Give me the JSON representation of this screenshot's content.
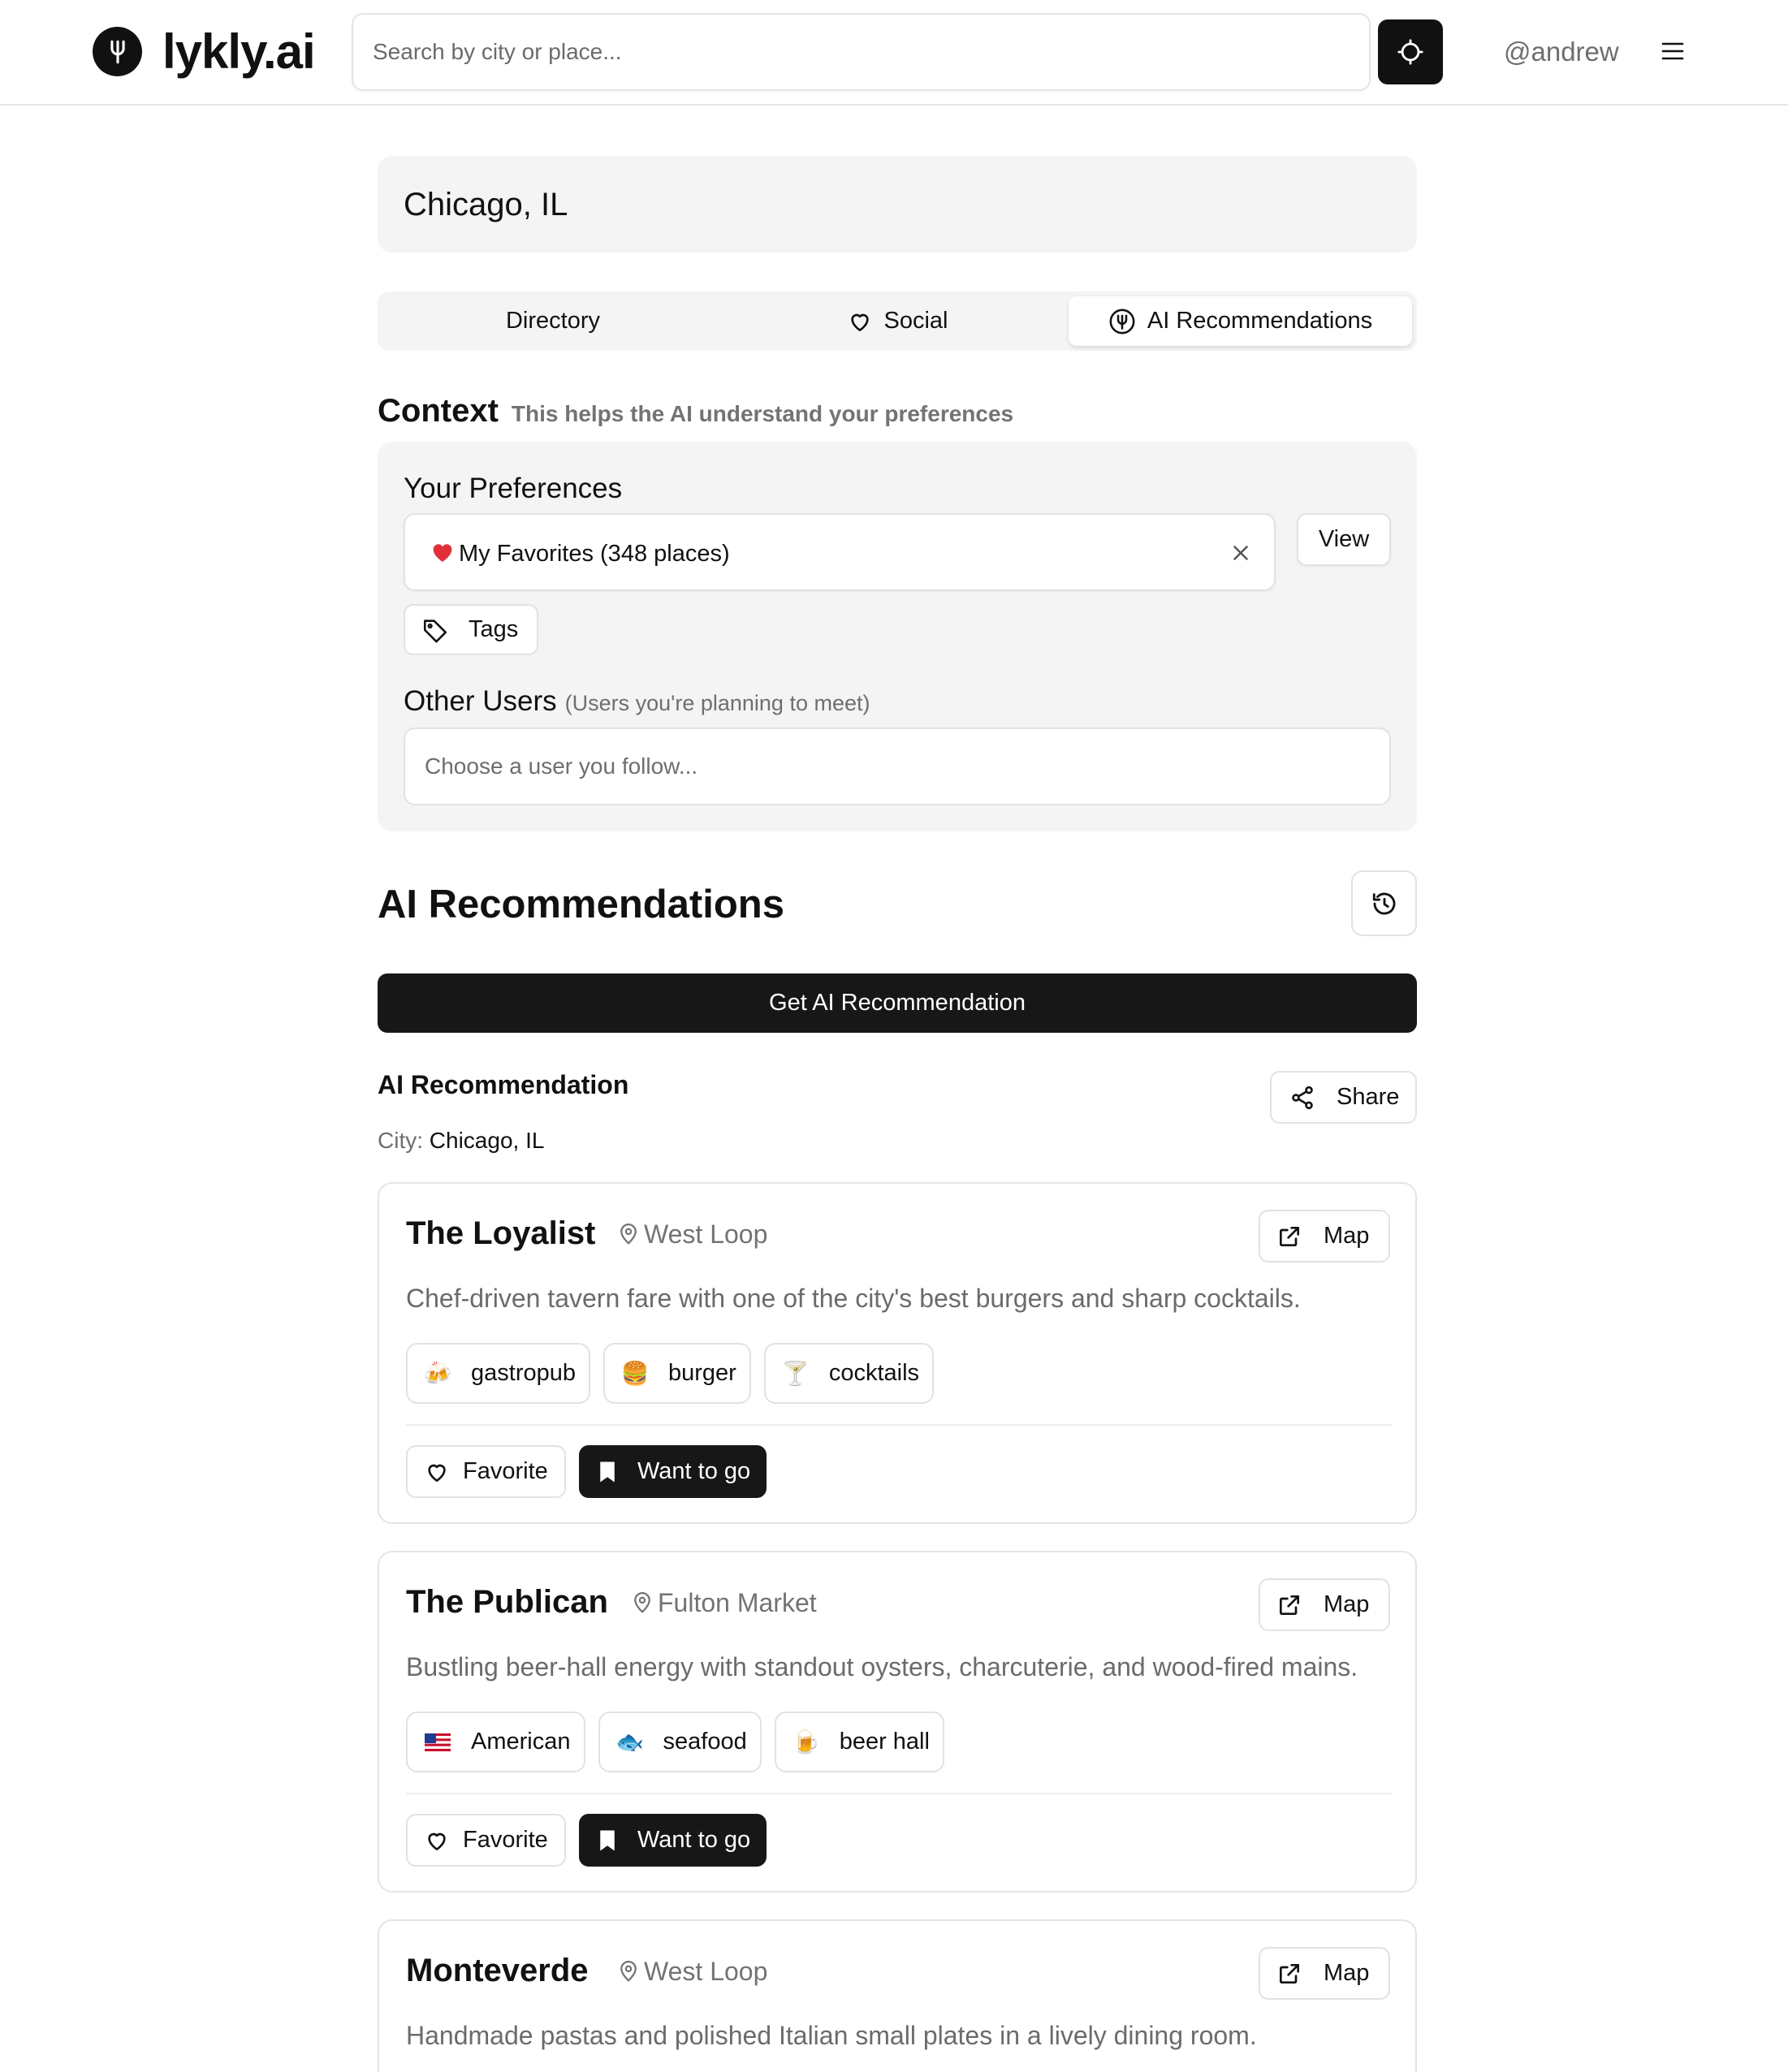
{
  "header": {
    "logo_text": "lykly.ai",
    "search_placeholder": "Search by city or place...",
    "username": "@andrew"
  },
  "city": {
    "name": "Chicago, IL"
  },
  "tabs": [
    {
      "label": "Directory",
      "active": false
    },
    {
      "label": "Social",
      "icon": "heart-icon",
      "active": false
    },
    {
      "label": "AI Recommendations",
      "icon": "fork-icon",
      "active": true
    }
  ],
  "context": {
    "title": "Context",
    "subtitle": "This helps the AI understand your preferences",
    "preferences_label": "Your Preferences",
    "favorites_value": "My Favorites (348 places)",
    "view_label": "View",
    "tags_label": "Tags",
    "other_users_label": "Other Users",
    "other_users_hint": "(Users you're planning to meet)",
    "other_users_placeholder": "Choose a user you follow..."
  },
  "ai": {
    "title": "AI Recommendations",
    "get_button": "Get AI Recommendation",
    "recommendation_title": "AI Recommendation",
    "share_label": "Share",
    "city_key": "City:",
    "city_value": "Chicago, IL"
  },
  "cards": [
    {
      "name": "The Loyalist",
      "neighborhood": "West Loop",
      "map_label": "Map",
      "description": "Chef-driven tavern fare with one of the city's best burgers and sharp cocktails.",
      "tags": [
        {
          "emoji": "🍻",
          "label": "gastropub"
        },
        {
          "emoji": "🍔",
          "label": "burger"
        },
        {
          "emoji": "🍸",
          "label": "cocktails"
        }
      ],
      "favorite_label": "Favorite",
      "want_label": "Want to go"
    },
    {
      "name": "The Publican",
      "neighborhood": "Fulton Market",
      "map_label": "Map",
      "description": "Bustling beer-hall energy with standout oysters, charcuterie, and wood-fired mains.",
      "tags": [
        {
          "emoji": "🇺🇸",
          "label": "American"
        },
        {
          "emoji": "🐟",
          "label": "seafood"
        },
        {
          "emoji": "🍺",
          "label": "beer hall"
        }
      ],
      "favorite_label": "Favorite",
      "want_label": "Want to go"
    },
    {
      "name": "Monteverde",
      "neighborhood": "West Loop",
      "map_label": "Map",
      "description": "Handmade pastas and polished Italian small plates in a lively dining room."
    }
  ],
  "colors": {
    "primary_dark": "#171717",
    "muted_text": "#6e6e6e",
    "panel_bg": "#f4f4f4",
    "border": "#e2e2e2",
    "heart_red": "#e0303a"
  }
}
